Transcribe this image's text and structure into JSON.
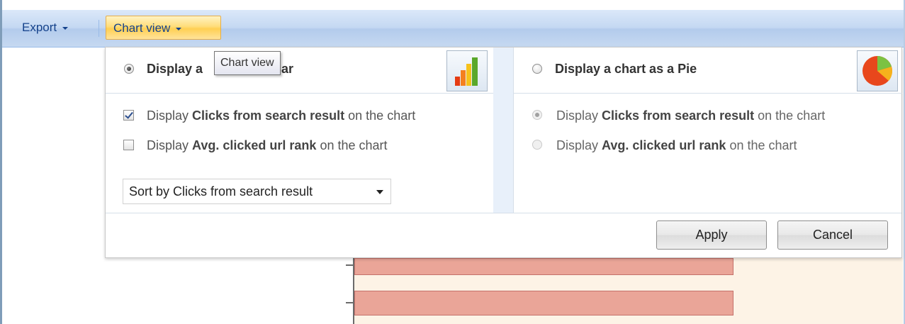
{
  "toolbar": {
    "export_label": "Export",
    "chart_view_label": "Chart view"
  },
  "tooltip": {
    "text": "Chart view"
  },
  "panel": {
    "bar": {
      "label_prefix": "Display a",
      "label_suffix": "Bar",
      "selected": true,
      "options": [
        {
          "pre": "Display ",
          "bold": "Clicks from search result",
          "post": " on the chart",
          "checked": true
        },
        {
          "pre": "Display ",
          "bold": "Avg. clicked url rank",
          "post": " on the chart",
          "checked": false
        }
      ],
      "sort_value": "Sort by Clicks from search result"
    },
    "pie": {
      "label": "Display a chart as a Pie",
      "selected": false,
      "options": [
        {
          "pre": "Display ",
          "bold": "Clicks from search result",
          "post": " on the chart",
          "checked": true
        },
        {
          "pre": "Display ",
          "bold": "Avg. clicked url rank",
          "post": " on the chart",
          "checked": false
        }
      ]
    },
    "apply_label": "Apply",
    "cancel_label": "Cancel"
  },
  "icons": {
    "bar_chart": "bar-chart-icon",
    "pie_chart": "pie-chart-icon"
  },
  "colors": {
    "toolbar_text": "#15428b",
    "active_button": "#ffdd7a",
    "chart_bar": "#eaa598",
    "chart_background": "#fdf3e6"
  }
}
